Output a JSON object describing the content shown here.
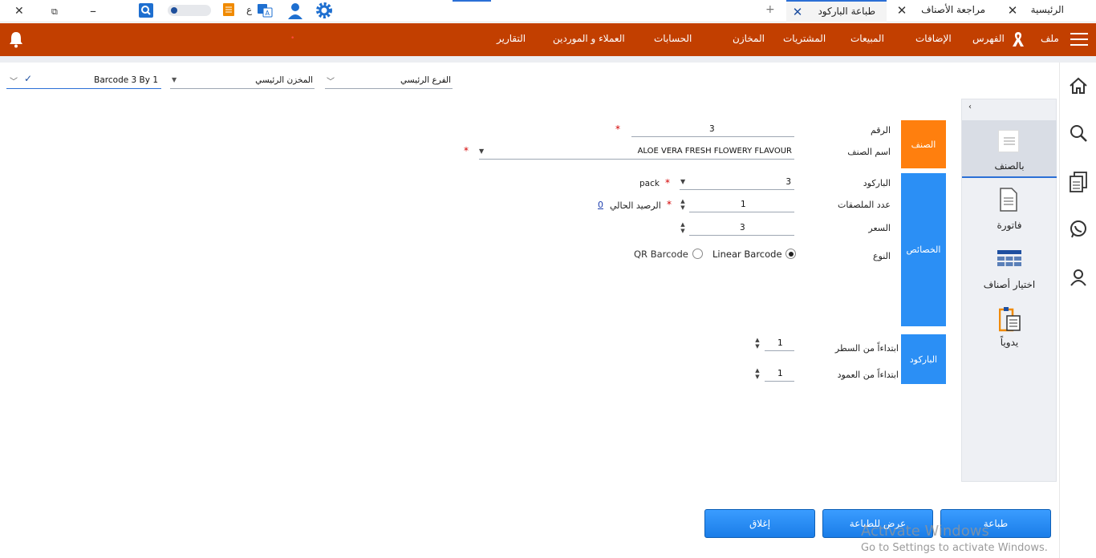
{
  "tabs": [
    {
      "label": "الرئيسية"
    },
    {
      "label": "مراجعة الأصناف"
    },
    {
      "label": "طباعة الباركود"
    }
  ],
  "toolbar": {
    "letter": "ع",
    "new_tab": "+"
  },
  "nav": {
    "file": "ملف",
    "items": [
      "الفهرس",
      "الإضافات",
      "المبيعات",
      "المشتريات",
      "المخازن",
      "الحسابات",
      "العملاء و الموردين",
      "التقارير"
    ]
  },
  "selectors": {
    "branch": "الفرع الرئيسي",
    "store": "المخزن الرئيسي",
    "template": "Barcode 3 By 1"
  },
  "side_menu": [
    {
      "label": "بالصنف"
    },
    {
      "label": "فاتورة"
    },
    {
      "label": "اختيار أصناف"
    },
    {
      "label": "يدوياً"
    }
  ],
  "sections": {
    "item": "الصنف",
    "properties": "الخصائص",
    "barcode": "الباركود"
  },
  "form": {
    "number_label": "الرقم",
    "number_value": "3",
    "name_label": "اسم الصنف",
    "name_value": "ALOE VERA FRESH FLOWERY FLAVOUR",
    "barcode_label": "الباركود",
    "barcode_value": "3",
    "unit": "pack",
    "labels_count_label": "عدد الملصقات",
    "labels_count_value": "1",
    "balance_label": "الرصيد الحالي",
    "balance_value": "0",
    "price_label": "السعر",
    "price_value": "3",
    "type_label": "النوع",
    "type_linear": "Linear Barcode",
    "type_qr": "QR Barcode",
    "start_row_label": "ابتداءاً من السطر",
    "start_row_value": "1",
    "start_col_label": "ابتداءاً من العمود",
    "start_col_value": "1"
  },
  "buttons": {
    "print": "طباعة",
    "preview": "عرض للطباعة",
    "close": "إغلاق"
  },
  "watermark": {
    "line1": "Activate Windows",
    "line2": "Go to Settings to activate Windows."
  },
  "colors": {
    "nav": "#c23f00",
    "section_orange": "#ff7f0e",
    "section_blue": "#2b8ff5",
    "button": "#1a7de8"
  }
}
